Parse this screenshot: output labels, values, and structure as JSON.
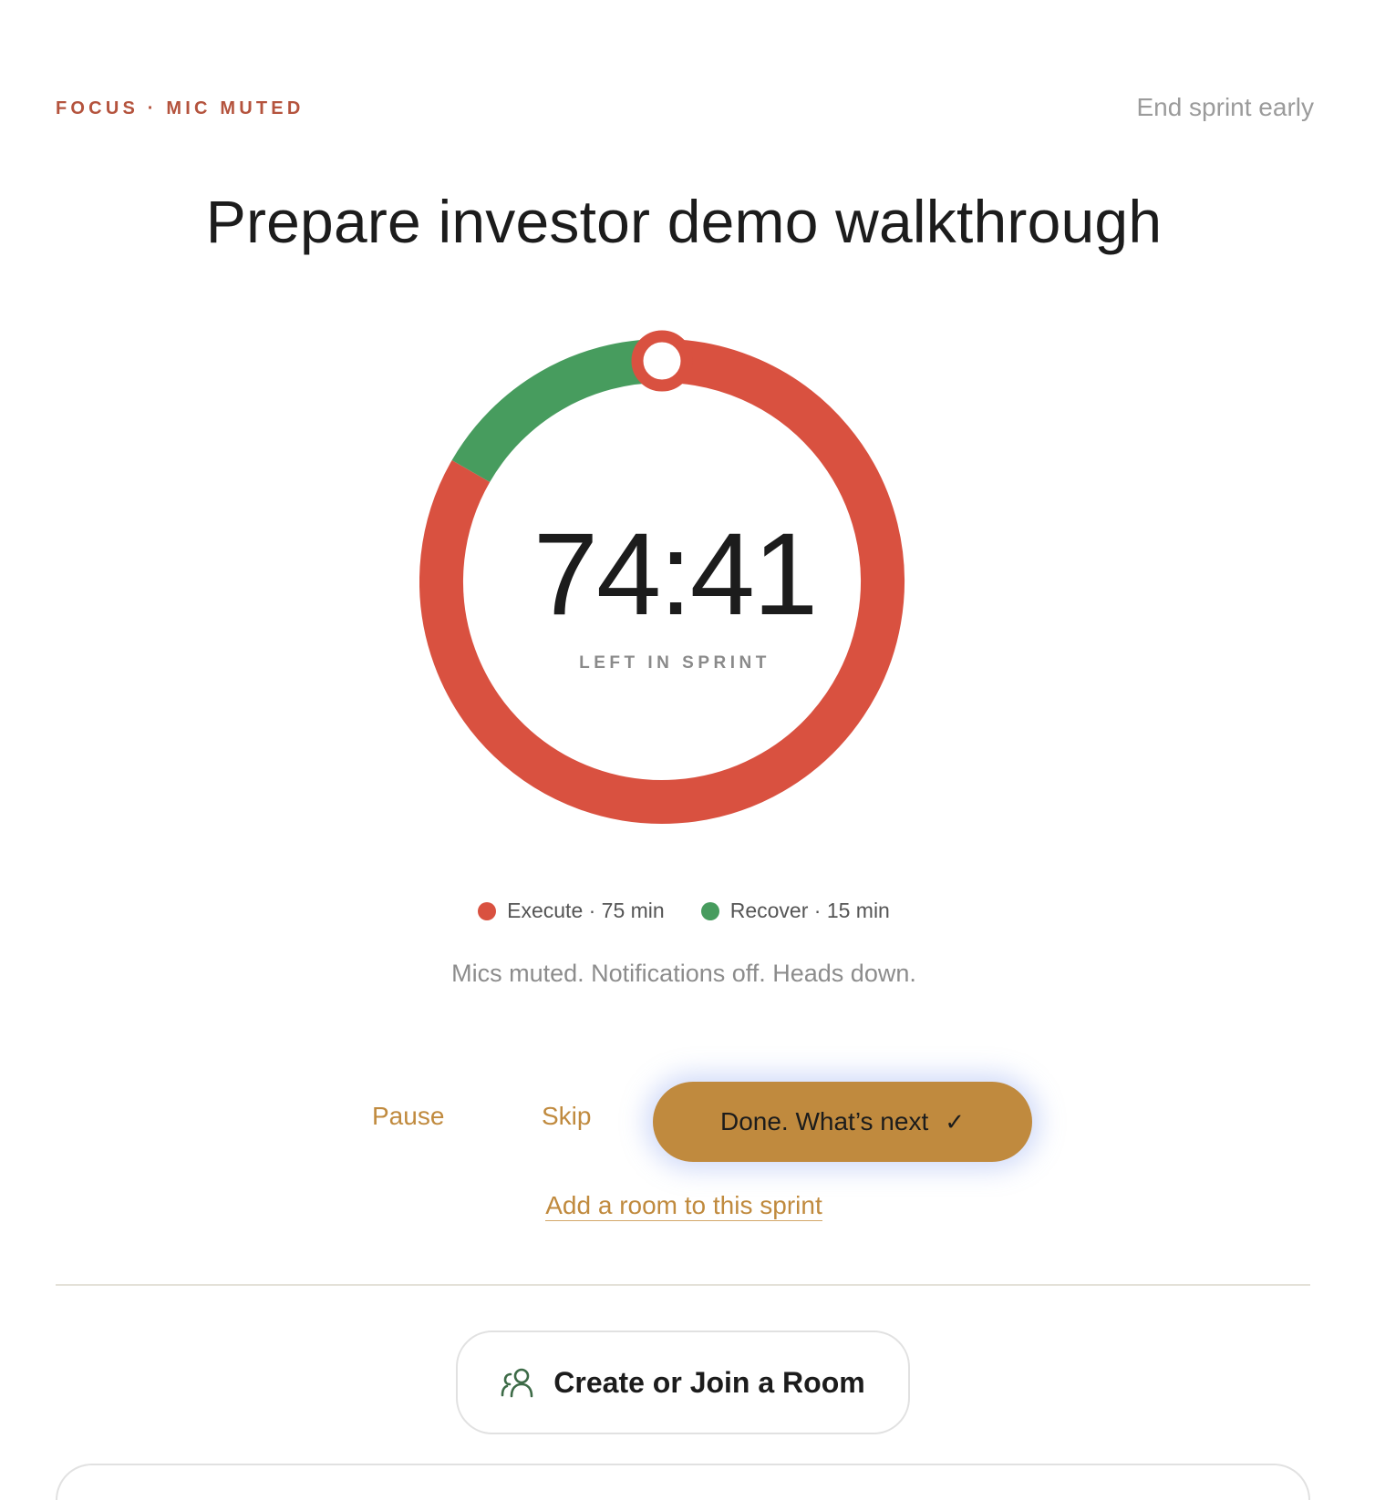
{
  "header": {
    "status_label": "FOCUS · MIC MUTED",
    "end_link": "End sprint early"
  },
  "task": {
    "title": "Prepare investor demo walkthrough"
  },
  "timer": {
    "time": "74:41",
    "caption": "LEFT IN SPRINT",
    "progress_fraction": 0.0,
    "segments": [
      {
        "name": "Execute",
        "minutes": 75,
        "color": "#d95140"
      },
      {
        "name": "Recover",
        "minutes": 15,
        "color": "#479c5e"
      }
    ]
  },
  "legend": {
    "execute": {
      "name": "Execute",
      "detail": " · 75 min",
      "color": "#d95140"
    },
    "recover": {
      "name": "Recover",
      "detail": " · 15 min",
      "color": "#479c5e"
    }
  },
  "status_text": "Mics muted. Notifications off. Heads down.",
  "controls": {
    "pause_label": "Pause",
    "skip_label": "Skip",
    "done_label": "Done. What’s next",
    "check_glyph": "✓"
  },
  "add_room_label": "Add a room to this sprint",
  "room_button_label": "Create or Join a Room",
  "colors": {
    "accent": "#c08a3e",
    "execute": "#d95140",
    "recover": "#479c5e",
    "status_label": "#b4533d"
  },
  "icons": {
    "room": "people-icon",
    "check": "check-icon"
  }
}
